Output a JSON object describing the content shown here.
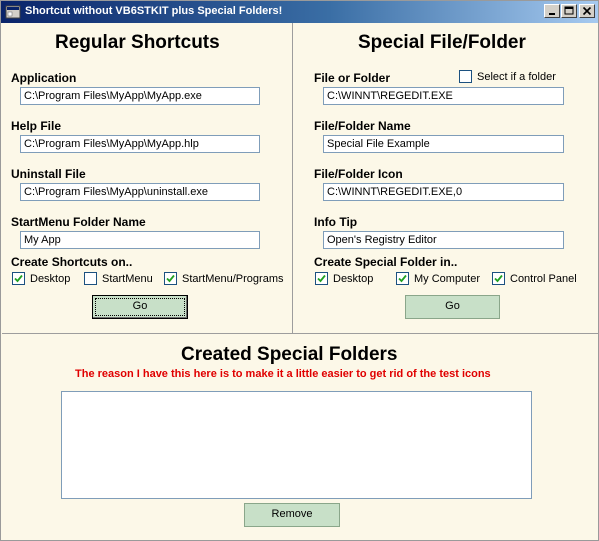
{
  "window": {
    "title": "Shortcut without VB6STKIT plus Special Folders!"
  },
  "regular": {
    "heading": "Regular Shortcuts",
    "application": {
      "label": "Application",
      "value": "C:\\Program Files\\MyApp\\MyApp.exe"
    },
    "help_file": {
      "label": "Help File",
      "value": "C:\\Program Files\\MyApp\\MyApp.hlp"
    },
    "uninstall_file": {
      "label": "Uninstall File",
      "value": "C:\\Program Files\\MyApp\\uninstall.exe"
    },
    "startmenu_folder": {
      "label": "StartMenu Folder Name",
      "value": "My App"
    },
    "create_on_label": "Create Shortcuts on..",
    "options": [
      {
        "label": "Desktop",
        "checked": true
      },
      {
        "label": "StartMenu",
        "checked": false
      },
      {
        "label": "StartMenu/Programs",
        "checked": true
      }
    ],
    "go_label": "Go"
  },
  "special": {
    "heading": "Special File/Folder",
    "file_or_folder": {
      "label": "File or Folder",
      "value": "C:\\WINNT\\REGEDIT.EXE"
    },
    "is_folder": {
      "label": "Select if a folder",
      "checked": false
    },
    "name": {
      "label": "File/Folder Name",
      "value": "Special File Example"
    },
    "icon": {
      "label": "File/Folder Icon",
      "value": "C:\\WINNT\\REGEDIT.EXE,0"
    },
    "info_tip": {
      "label": "Info Tip",
      "value": "Open's Registry Editor"
    },
    "create_in_label": "Create Special Folder in..",
    "options": [
      {
        "label": "Desktop",
        "checked": true
      },
      {
        "label": "My Computer",
        "checked": true
      },
      {
        "label": "Control Panel",
        "checked": true
      }
    ],
    "go_label": "Go"
  },
  "created": {
    "heading": "Created Special Folders",
    "note": "The reason I have this here is to make it a little easier to get rid of the test icons",
    "remove_label": "Remove"
  },
  "colors": {
    "background": "#fcf8e8",
    "button": "#c8e0c8",
    "note_text": "#e00000",
    "titlebar_start": "#0a246a",
    "titlebar_end": "#a6caf0"
  }
}
